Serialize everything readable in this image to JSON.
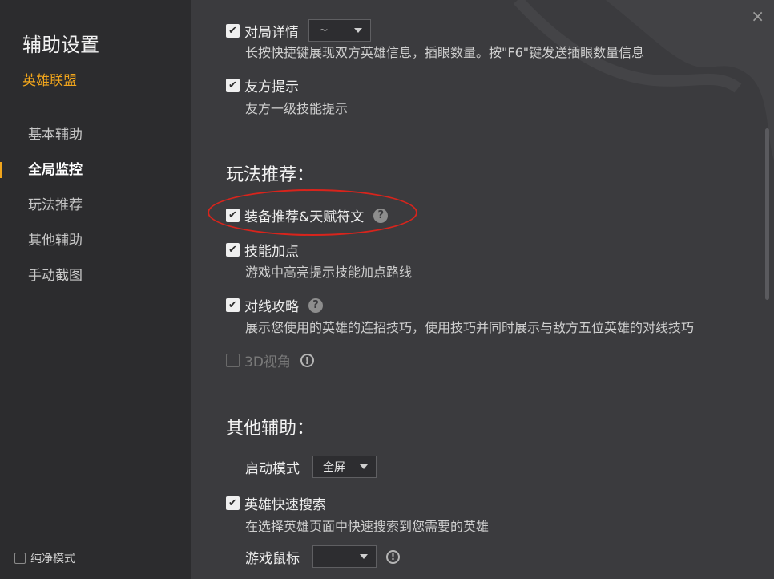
{
  "sidebar": {
    "title": "辅助设置",
    "subtitle": "英雄联盟",
    "items": [
      {
        "label": "基本辅助"
      },
      {
        "label": "全局监控"
      },
      {
        "label": "玩法推荐"
      },
      {
        "label": "其他辅助"
      },
      {
        "label": "手动截图"
      }
    ],
    "active_index": 1,
    "pure_mode_label": "纯净模式"
  },
  "main": {
    "close_label": "×",
    "top_section": {
      "enemy_info": {
        "label": "对局详情",
        "select_value": "~",
        "desc": "长按快捷键展现双方英雄信息，插眼数量。按\"F6\"键发送插眼数量信息"
      },
      "ally_tip": {
        "label": "友方提示",
        "desc": "友方一级技能提示"
      }
    },
    "gameplay_section": {
      "title": "玩法推荐：",
      "equip_rune": {
        "label": "装备推荐&天赋符文"
      },
      "skill_points": {
        "label": "技能加点",
        "desc": "游戏中高亮提示技能加点路线"
      },
      "lane_strategy": {
        "label": "对线攻略",
        "desc": "展示您使用的英雄的连招技巧，使用技巧并同时展示与敌方五位英雄的对线技巧"
      },
      "view3d": {
        "label": "3D视角"
      }
    },
    "other_section": {
      "title": "其他辅助：",
      "launch_mode": {
        "label": "启动模式",
        "select_value": "全屏"
      },
      "hero_search": {
        "label": "英雄快速搜索",
        "desc": "在选择英雄页面中快速搜索到您需要的英雄"
      },
      "game_mouse": {
        "label": "游戏鼠标",
        "select_value": ""
      }
    },
    "icons": {
      "check": "✔",
      "help": "?",
      "warn": "!"
    }
  },
  "colors": {
    "accent": "#f0a51c",
    "highlight": "#d8241c"
  }
}
